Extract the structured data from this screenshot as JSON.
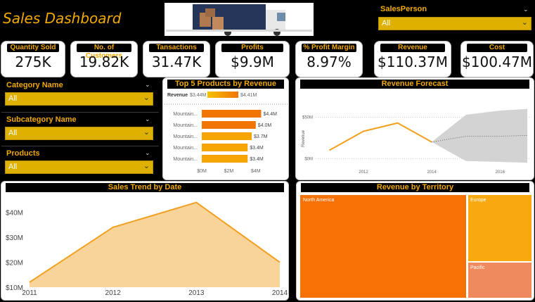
{
  "header": {
    "title": "Sales Dashboard",
    "banner_text": "Truck Banner"
  },
  "salesperson": {
    "label": "SalesPerson",
    "value": "All"
  },
  "kpis": [
    {
      "label": "Quantity Sold",
      "value": "275K"
    },
    {
      "label": "No. of Customers",
      "value": "19.82K"
    },
    {
      "label": "Tansactions",
      "value": "31.47K"
    },
    {
      "label": "Profits",
      "value": "$9.9M"
    },
    {
      "label": "% Profit Margin",
      "value": "8.97%"
    },
    {
      "label": "Revenue",
      "value": "$110.37M"
    },
    {
      "label": "Cost",
      "value": "$100.47M"
    }
  ],
  "filters": [
    {
      "label": "Category Name",
      "value": "All"
    },
    {
      "label": "Subcategory Name",
      "value": "All"
    },
    {
      "label": "Products",
      "value": "All"
    }
  ],
  "colors": {
    "accent": "#F2A900",
    "bar_dark": "#F27405",
    "bar_light": "#F6A500",
    "area": "#F8D49A",
    "line": "#F2A020",
    "north_america": "#F77105",
    "europe": "#F8A90F",
    "pacific": "#EE8A5E",
    "forecast_band": "#D3D3D3"
  },
  "chart_data": [
    {
      "type": "bar",
      "title": "Top 5 Products by Revenue",
      "legend_label": "Revenue",
      "legend_min": "$3.44M",
      "legend_max": "$4.41M",
      "categories": [
        "Mountain...",
        "Mountain...",
        "Mountain...",
        "Mountain...",
        "Mountain..."
      ],
      "values": [
        4.4,
        4.0,
        3.7,
        3.4,
        3.4
      ],
      "data_labels": [
        "$4.4M",
        "$4.0M",
        "$3.7M",
        "$3.4M",
        "$3.4M"
      ],
      "x_ticks": [
        "$0M",
        "$2M",
        "$4M"
      ],
      "xlim": [
        0,
        5
      ]
    },
    {
      "type": "line",
      "title": "Revenue Forecast",
      "ylabel": "Revenue",
      "x": [
        2011,
        2012,
        2013,
        2014
      ],
      "values": [
        10,
        33,
        43,
        20
      ],
      "forecast": {
        "x": [
          2014,
          2015,
          2016,
          2016.8
        ],
        "mid": [
          20,
          27,
          27,
          28
        ],
        "upper": [
          20,
          53,
          58,
          60
        ],
        "lower": [
          20,
          -3,
          -4,
          -5
        ]
      },
      "x_ticks": [
        "2012",
        "2014",
        "2016"
      ],
      "y_ticks": [
        "$0M",
        "$50M"
      ],
      "ylim": [
        -10,
        70
      ],
      "xlim": [
        2010.6,
        2016.9
      ]
    },
    {
      "type": "area",
      "title": "Sales Trend by Date",
      "x": [
        "2011",
        "2012",
        "2013",
        "2014"
      ],
      "values": [
        12,
        34,
        44,
        20
      ],
      "y_ticks": [
        "$40M",
        "$30M",
        "$20M",
        "$10M"
      ],
      "ylim": [
        10,
        45
      ]
    },
    {
      "type": "treemap",
      "title": "Revenue by Territory",
      "categories": [
        "North America",
        "Europe",
        "Pacific"
      ]
    }
  ]
}
